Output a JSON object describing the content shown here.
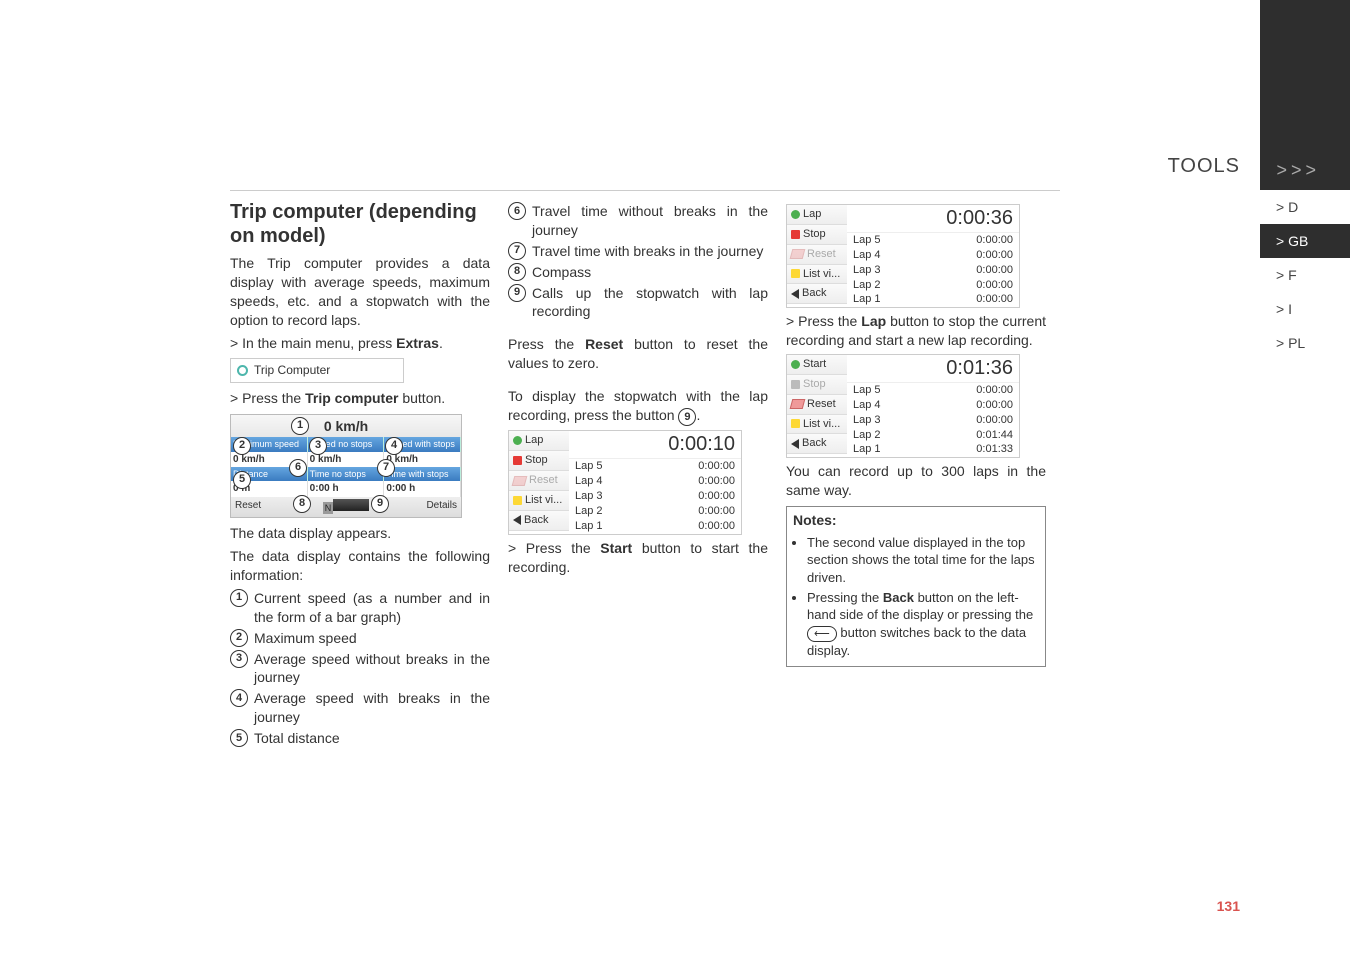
{
  "header": {
    "section": "TOOLS",
    "chevrons": ">>>"
  },
  "sidebar": {
    "items": [
      {
        "label": "> D"
      },
      {
        "label": "> GB"
      },
      {
        "label": "> F"
      },
      {
        "label": "> I"
      },
      {
        "label": "> PL"
      }
    ],
    "active_index": 1
  },
  "col1": {
    "title": "Trip computer (depending on model)",
    "intro": "The Trip computer provides a data display with average speeds, maximum speeds, etc. and a stopwatch with the option to record laps.",
    "step1_prefix": "> In the main menu, press ",
    "step1_bold": "Extras",
    "step1_suffix": ".",
    "menuitem": "Trip Computer",
    "step2_prefix": "> Press the ",
    "step2_bold": "Trip computer",
    "step2_suffix": " button.",
    "datadisplay": {
      "top_speed": "0 km/h",
      "labels_row": [
        "Maximum speed",
        "Speed no stops",
        "Speed with stops"
      ],
      "values_row": [
        "0 km/h",
        "0 km/h",
        "0 km/h"
      ],
      "labels_row2": [
        "Distance",
        "Time no stops",
        "Time with stops"
      ],
      "values_row2": [
        "0 m",
        "0:00 h",
        "0:00 h"
      ],
      "bottom_left": "Reset",
      "bottom_right": "Details"
    },
    "after1": "The data display appears.",
    "after2": "The data display contains the following information:",
    "list": [
      "Current speed (as a number and in the form of a bar graph)",
      "Maximum speed",
      "Average speed without breaks in the journey",
      "Average speed with breaks in the journey",
      "Total distance"
    ]
  },
  "col2": {
    "list_cont": [
      "Travel time without breaks in the journey",
      "Travel time with breaks in the journey",
      "Compass",
      "Calls up the stopwatch with lap recording"
    ],
    "reset_p_a": "Press the ",
    "reset_bold": "Reset",
    "reset_p_b": " button to reset the values to zero.",
    "disp_p_a": "To display the stopwatch with the lap recording, press the button ",
    "disp_num": "9",
    "disp_p_b": ".",
    "lapbox1": {
      "side": [
        "Lap",
        "Stop",
        "Reset",
        "List vi...",
        "Back"
      ],
      "big": "0:00:10",
      "rows": [
        {
          "l": "Lap 5",
          "v": "0:00:00"
        },
        {
          "l": "Lap 4",
          "v": "0:00:00"
        },
        {
          "l": "Lap 3",
          "v": "0:00:00"
        },
        {
          "l": "Lap 2",
          "v": "0:00:00"
        },
        {
          "l": "Lap 1",
          "v": "0:00:00"
        }
      ]
    },
    "start_p_a": "> Press the ",
    "start_bold": "Start",
    "start_p_b": " button to start the recording."
  },
  "col3": {
    "lapbox2": {
      "side": [
        "Lap",
        "Stop",
        "Reset",
        "List vi...",
        "Back"
      ],
      "big": "0:00:36",
      "rows": [
        {
          "l": "Lap 5",
          "v": "0:00:00"
        },
        {
          "l": "Lap 4",
          "v": "0:00:00"
        },
        {
          "l": "Lap 3",
          "v": "0:00:00"
        },
        {
          "l": "Lap 2",
          "v": "0:00:00"
        },
        {
          "l": "Lap 1",
          "v": "0:00:00"
        }
      ]
    },
    "lap_p_a": "> Press the ",
    "lap_bold": "Lap",
    "lap_p_b": " button to stop the current recording and start a new lap recording.",
    "lapbox3": {
      "side": [
        "Start",
        "Stop",
        "Reset",
        "List vi...",
        "Back"
      ],
      "big": "0:01:36",
      "rows": [
        {
          "l": "Lap 5",
          "v": "0:00:00"
        },
        {
          "l": "Lap 4",
          "v": "0:00:00"
        },
        {
          "l": "Lap 3",
          "v": "0:00:00"
        },
        {
          "l": "Lap 2",
          "v": "0:01:44"
        },
        {
          "l": "Lap 1",
          "v": "0:01:33"
        }
      ]
    },
    "note_after": "You can record up to 300 laps in the same way.",
    "notes_title": "Notes:",
    "note1": "The second value displayed in the top section shows the total time for the laps driven.",
    "note2a": "Pressing the ",
    "note2bold": "Back",
    "note2b": " button on the left-hand side of the display or pressing the ",
    "note2c": " button switches back to the data display."
  },
  "page_number": "131"
}
